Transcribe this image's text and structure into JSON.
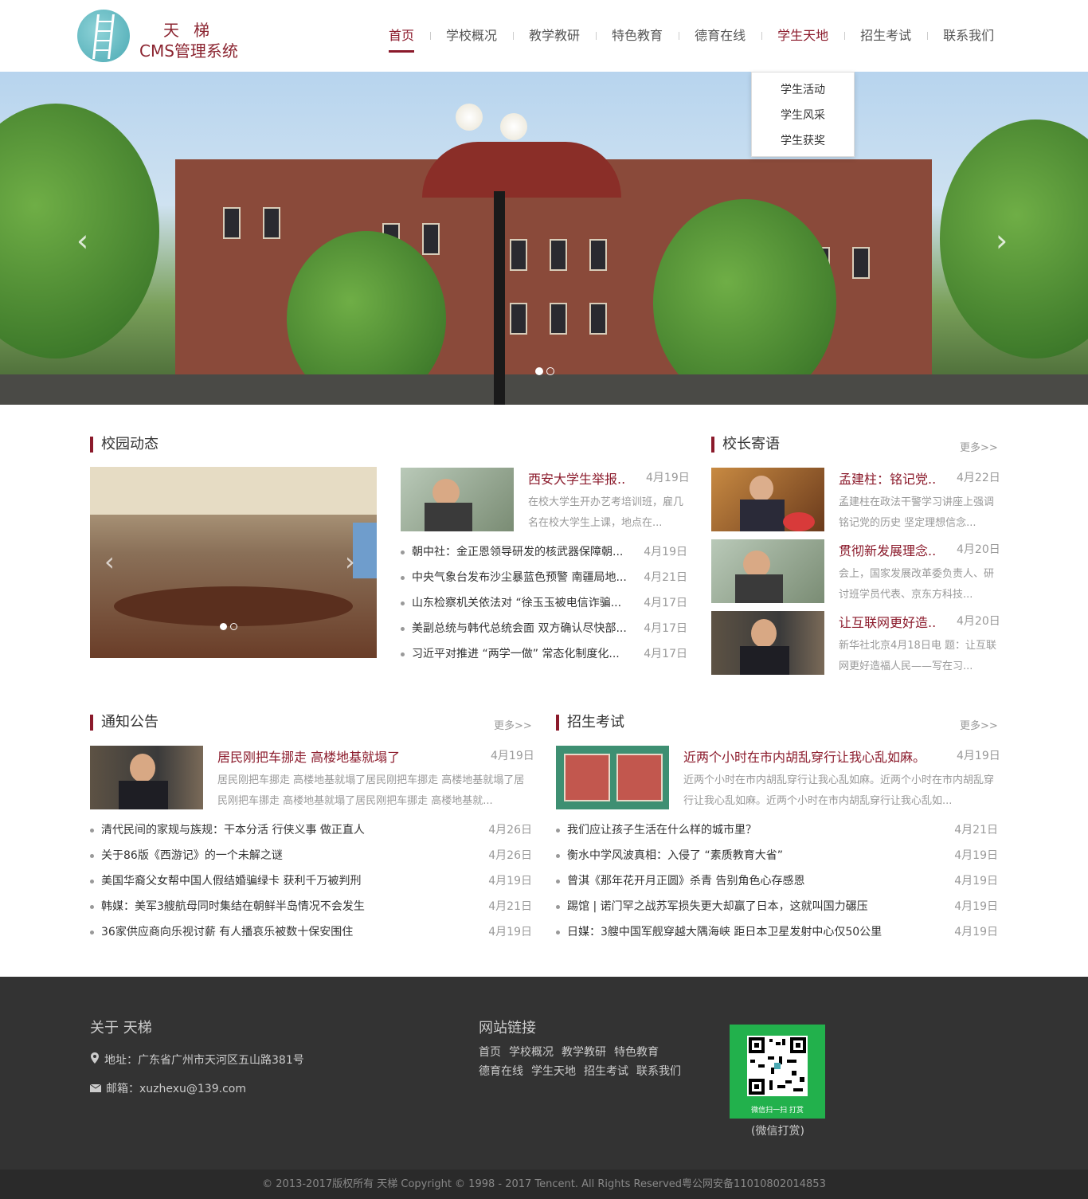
{
  "logo": {
    "line1": "天梯",
    "line2": "CMS管理系统"
  },
  "nav": {
    "items": [
      "首页",
      "学校概况",
      "教学教研",
      "特色教育",
      "德育在线",
      "学生天地",
      "招生考试",
      "联系我们"
    ],
    "dropdown": [
      "学生活动",
      "学生风采",
      "学生获奖"
    ]
  },
  "banner": {
    "prev": "‹",
    "next": "›"
  },
  "campus": {
    "title": "校园动态",
    "featured": {
      "title": "西安大学生举报..",
      "date": "4月19日",
      "desc": "在校大学生开办艺考培训班，雇几名在校大学生上课，地点在..."
    },
    "list": [
      {
        "title": "朝中社：金正恩领导研发的核武器保障朝...",
        "date": "4月19日"
      },
      {
        "title": "中央气象台发布沙尘暴蓝色预警 南疆局地...",
        "date": "4月21日"
      },
      {
        "title": "山东检察机关依法对 “徐玉玉被电信诈骗...",
        "date": "4月17日"
      },
      {
        "title": "美副总统与韩代总统会面 双方确认尽快部...",
        "date": "4月17日"
      },
      {
        "title": "习近平对推进 “两学一做” 常态化制度化...",
        "date": "4月17日"
      }
    ]
  },
  "principal": {
    "title": "校长寄语",
    "more": "更多>>",
    "items": [
      {
        "title": "孟建柱：铭记党..",
        "date": "4月22日",
        "desc": "孟建柱在政法干警学习讲座上强调铭记党的历史 坚定理想信念..."
      },
      {
        "title": "贯彻新发展理念..",
        "date": "4月20日",
        "desc": "会上，国家发展改革委负责人、研讨班学员代表、京东方科技..."
      },
      {
        "title": "让互联网更好造..",
        "date": "4月20日",
        "desc": "新华社北京4月18日电 题：让互联网更好造福人民——写在习..."
      }
    ]
  },
  "notice": {
    "title": "通知公告",
    "more": "更多>>",
    "featured": {
      "title": "居民刚把车挪走 高楼地基就塌了",
      "date": "4月19日",
      "desc": "居民刚把车挪走 高楼地基就塌了居民刚把车挪走 高楼地基就塌了居民刚把车挪走 高楼地基就塌了居民刚把车挪走 高楼地基就..."
    },
    "list": [
      {
        "title": "清代民间的家规与族规：干本分活 行侠义事 做正直人",
        "date": "4月26日"
      },
      {
        "title": "关于86版《西游记》的一个未解之谜",
        "date": "4月26日"
      },
      {
        "title": "美国华裔父女帮中国人假结婚骗绿卡 获利千万被判刑",
        "date": "4月19日"
      },
      {
        "title": "韩媒：美军3艘航母同时集结在朝鲜半岛情况不会发生",
        "date": "4月21日"
      },
      {
        "title": "36家供应商向乐视讨薪 有人播哀乐被数十保安围住",
        "date": "4月19日"
      }
    ]
  },
  "admission": {
    "title": "招生考试",
    "more": "更多>>",
    "featured": {
      "title": "近两个小时在市内胡乱穿行让我心乱如麻。",
      "date": "4月19日",
      "desc": "近两个小时在市内胡乱穿行让我心乱如麻。近两个小时在市内胡乱穿行让我心乱如麻。近两个小时在市内胡乱穿行让我心乱如..."
    },
    "list": [
      {
        "title": "我们应让孩子生活在什么样的城市里？",
        "date": "4月21日"
      },
      {
        "title": "衡水中学风波真相：入侵了 “素质教育大省”",
        "date": "4月19日"
      },
      {
        "title": "曾淇《那年花开月正圆》杀青 告别角色心存感恩",
        "date": "4月19日"
      },
      {
        "title": "踢馆 | 诺门罕之战苏军损失更大却赢了日本，这就叫国力碾压",
        "date": "4月19日"
      },
      {
        "title": "日媒：3艘中国军舰穿越大隅海峡 距日本卫星发射中心仅50公里",
        "date": "4月19日"
      }
    ]
  },
  "footer": {
    "about_title": "关于 天梯",
    "address": "地址：广东省广州市天河区五山路381号",
    "email": "邮箱：xuzhexu@139.com",
    "links_title": "网站链接",
    "links": [
      "首页",
      "学校概况",
      "教学教研",
      "特色教育",
      "德育在线",
      "学生天地",
      "招生考试",
      "联系我们"
    ],
    "qr_caption": "微信扫一扫 打赏",
    "qr_label": "(微信打赏)",
    "copyright": "© 2013-2017版权所有 天梯 Copyright © 1998 - 2017 Tencent. All Rights Reserved粤公网安备11010802014853"
  },
  "colors": {
    "accent": "#8b1a2b",
    "footer_bg": "#333333",
    "qr_green": "#22b14c"
  }
}
